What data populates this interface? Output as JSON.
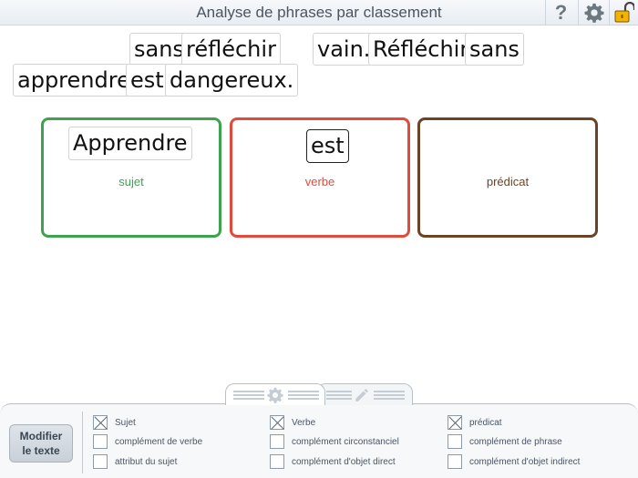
{
  "titlebar": {
    "title": "Analyse de phrases par classement",
    "help_label": "?",
    "icons": [
      "help-icon",
      "gear-icon",
      "unlock-icon"
    ]
  },
  "words": [
    {
      "text": "sans"
    },
    {
      "text": "réfléchir"
    },
    {
      "text": "vain."
    },
    {
      "text": "Réfléchir"
    },
    {
      "text": "sans"
    },
    {
      "text": "apprendre"
    },
    {
      "text": "est"
    },
    {
      "text": "dangereux."
    }
  ],
  "categories": [
    {
      "label": "sujet",
      "color": "#3ea34f",
      "word": "Apprendre"
    },
    {
      "label": "verbe",
      "color": "#e24a3c",
      "word": "est"
    },
    {
      "label": "prédicat",
      "color": "#6b4425",
      "word": ""
    }
  ],
  "panel": {
    "tabs": [
      "settings-tab",
      "edit-tab"
    ],
    "modify_button": {
      "line1": "Modifier",
      "line2": "le texte"
    },
    "options": [
      {
        "label": "Sujet",
        "checked": true
      },
      {
        "label": "complément de verbe",
        "checked": false
      },
      {
        "label": "attribut du sujet",
        "checked": false
      },
      {
        "label": "Verbe",
        "checked": true
      },
      {
        "label": "complément circonstanciel",
        "checked": false
      },
      {
        "label": "complément d'objet direct",
        "checked": false
      },
      {
        "label": "prédicat",
        "checked": true
      },
      {
        "label": "complément de phrase",
        "checked": false
      },
      {
        "label": "complément d'objet indirect",
        "checked": false
      }
    ]
  }
}
